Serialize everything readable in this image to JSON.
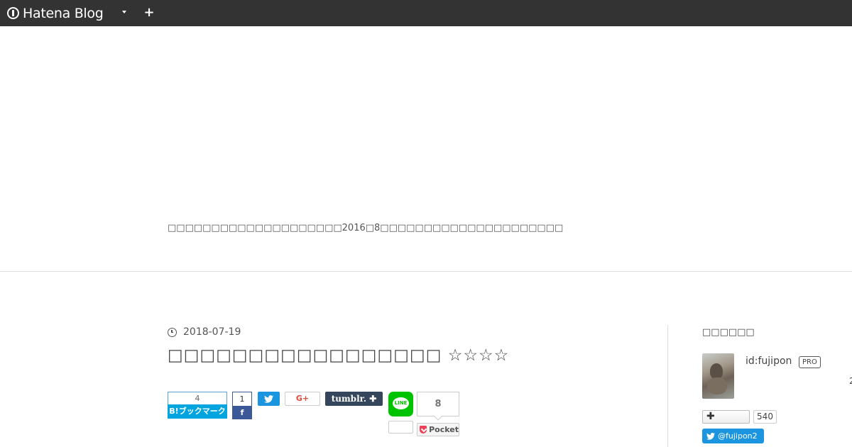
{
  "topbar": {
    "brand": "Hatena Blog",
    "plus_label": "+"
  },
  "header": {
    "description": "□□□□□□□□□□□□□□□□□□□□2016□8□□□□□□□□□□□□□□□□□□□□□"
  },
  "entry": {
    "date": "2018-07-19",
    "title": "□□□□□□□□□□□□□□□□□ ☆☆☆☆"
  },
  "share": {
    "hatena_count": "4",
    "hatena_label": "B!ブックマーク",
    "facebook_count": "1",
    "facebook_label": "f",
    "twitter_label": "🐦",
    "googleplus_label": "G+",
    "tumblr_label": "tumblr. ✚",
    "line_label": "LINE",
    "pocket_count": "8",
    "pocket_label": "Pocket"
  },
  "sidebar": {
    "title": "□□□□□□",
    "profile_id": "id:fujipon",
    "pro_badge": "PRO",
    "subscribe_label": "✚",
    "subscribe_count": "540",
    "twitter_handle": "@fujipon2",
    "edge_glyph": "2"
  },
  "colors": {
    "topbar": "#333333",
    "hatena": "#00a4de",
    "facebook": "#3b5998",
    "twitter": "#1b95e0",
    "tumblr": "#35465c",
    "line": "#00c300",
    "pocket": "#ee4056"
  }
}
